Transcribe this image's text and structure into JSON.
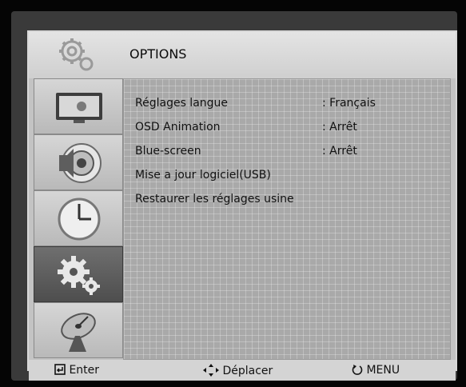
{
  "header": {
    "title": "OPTIONS",
    "icon": "gears-icon"
  },
  "sidebar": {
    "items": [
      {
        "name": "picture",
        "icon": "monitor-icon",
        "active": false
      },
      {
        "name": "sound",
        "icon": "speaker-icon",
        "active": false
      },
      {
        "name": "time",
        "icon": "clock-icon",
        "active": false
      },
      {
        "name": "options",
        "icon": "gears-icon",
        "active": true
      },
      {
        "name": "channel",
        "icon": "satellite-dish-icon",
        "active": false
      }
    ]
  },
  "menu": {
    "items": [
      {
        "label": "Réglages langue",
        "value": ": Français"
      },
      {
        "label": "OSD Animation",
        "value": ": Arrêt"
      },
      {
        "label": "Blue-screen",
        "value": ": Arrêt"
      },
      {
        "label": "Mise a jour logiciel(USB)",
        "value": ""
      },
      {
        "label": "Restaurer les réglages usine",
        "value": ""
      }
    ]
  },
  "footer": {
    "enter_label": "Enter",
    "move_label": "Déplacer",
    "menu_label": "MENU"
  }
}
